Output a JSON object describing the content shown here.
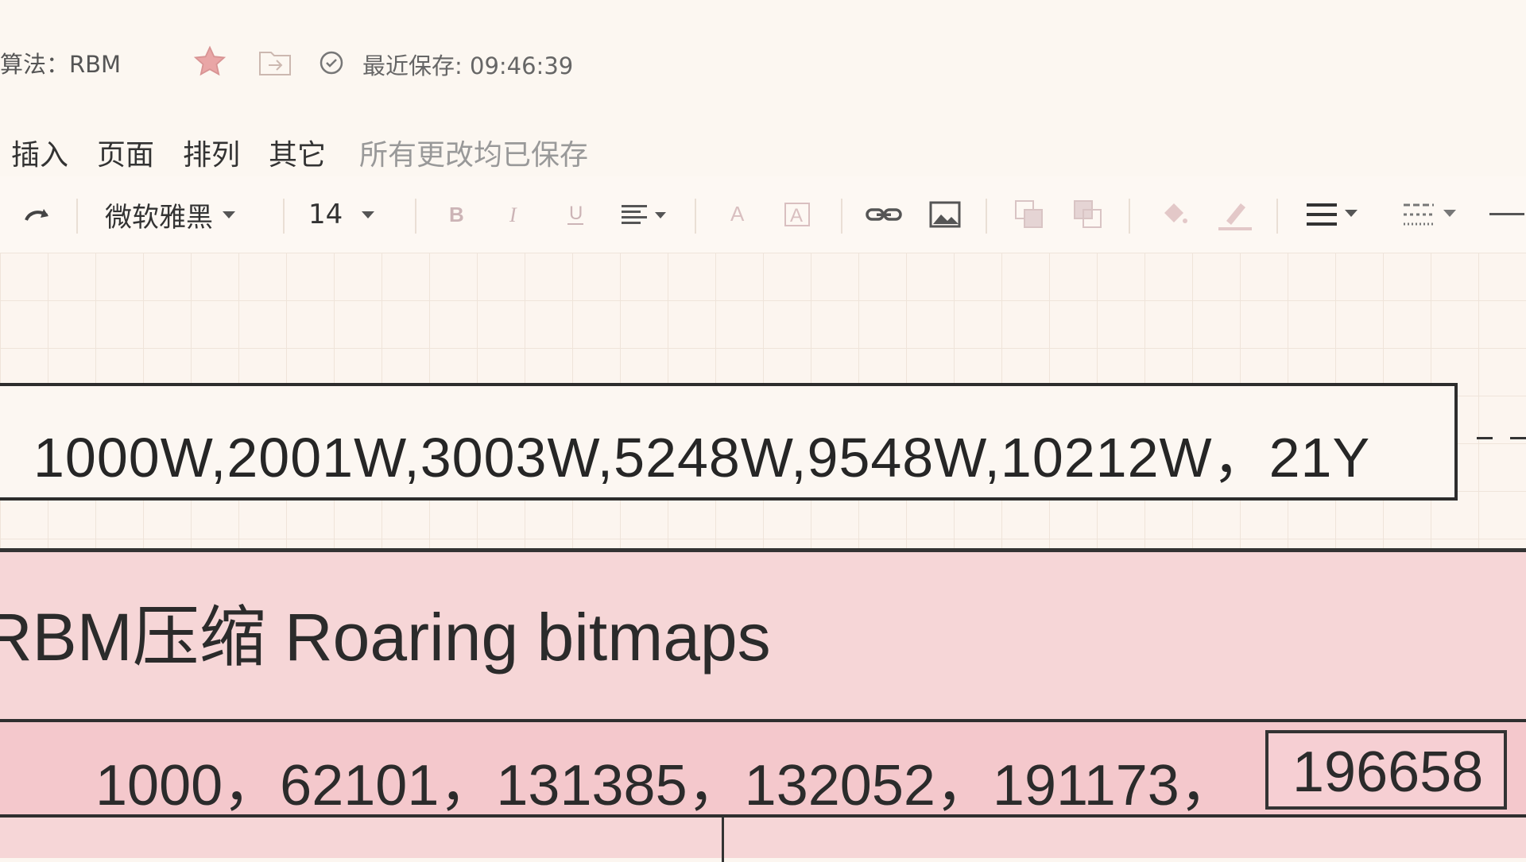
{
  "header": {
    "title": "算法：RBM",
    "save_status": "最近保存: 09:46:39",
    "icons": [
      "star-icon",
      "move-to-folder-icon",
      "check-circle-icon"
    ]
  },
  "menu": {
    "items": [
      "插入",
      "页面",
      "排列",
      "其它"
    ],
    "status": "所有更改均已保存"
  },
  "toolbar": {
    "font_family": "微软雅黑",
    "font_size": "14",
    "icons": [
      "redo-icon",
      "bold-icon",
      "italic-icon",
      "underline-icon",
      "align-icon",
      "font-color-icon",
      "text-background-icon",
      "link-icon",
      "image-icon",
      "bring-front-icon",
      "send-back-icon",
      "fill-color-icon",
      "line-color-icon",
      "line-style-icon",
      "dash-style-icon",
      "line-end-icon"
    ]
  },
  "canvas": {
    "box1_text": "1000W,2001W,3003W,5248W,9548W,10212W，21Y",
    "pink_title": "RBM压缩  Roaring bitmaps",
    "row_values": "1000，62101，131385，132052，191173，",
    "highlight_value": "196658"
  },
  "colors": {
    "background": "#fcf6f0",
    "panel_pink": "#f6d6d7",
    "row_pink": "#f4c8cc",
    "border": "#2d2d2d"
  }
}
